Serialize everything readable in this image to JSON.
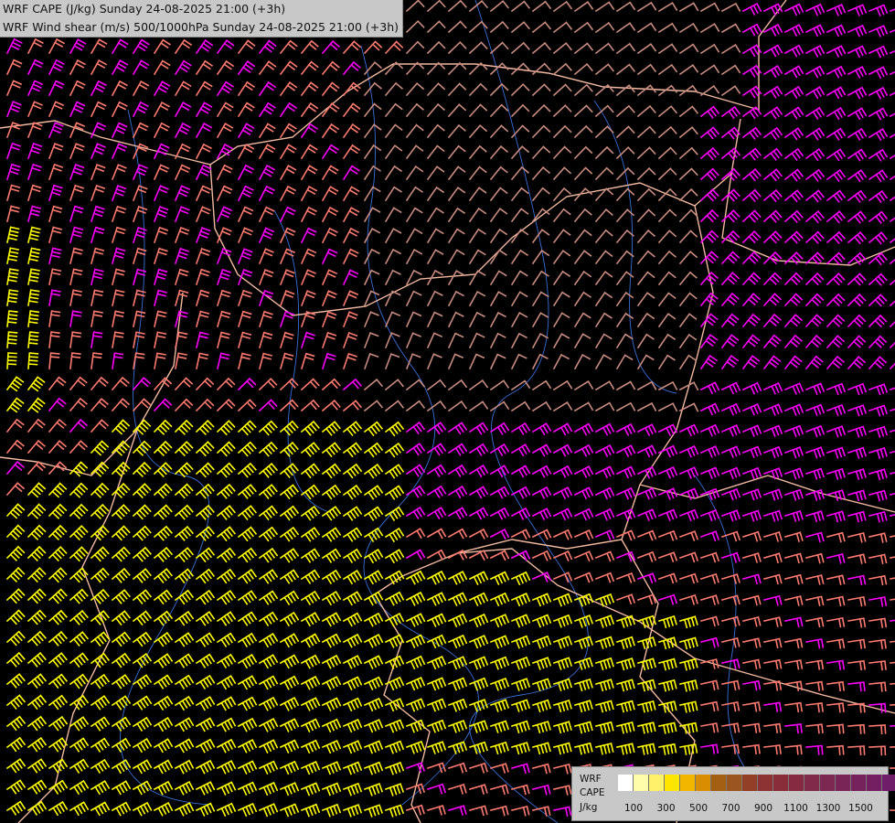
{
  "header": {
    "line1": "WRF CAPE (J/kg) Sunday 24-08-2025 21:00 (+3h)",
    "line2": "WRF Wind shear (m/s) 500/1000hPa Sunday 24-08-2025 21:00 (+3h)"
  },
  "legend": {
    "line_wrf": "WRF",
    "line_cape": "CAPE",
    "line_unit": "J/kg",
    "colors": [
      "#ffffff",
      "#fffcaa",
      "#fff26a",
      "#ffe600",
      "#f2b500",
      "#d98d00",
      "#a35f12",
      "#9a5520",
      "#933e26",
      "#8e3333",
      "#8a2d3a",
      "#862a42",
      "#822a4a",
      "#7d2852",
      "#7a2558",
      "#76235d",
      "#731f62",
      "#6f1d68",
      "#6b1a6d"
    ],
    "ticks": [
      "100",
      "300",
      "500",
      "700",
      "900",
      "1100",
      "1300",
      "1500"
    ]
  },
  "colors": {
    "background": "#000000",
    "border_lines": "#f2b8a0",
    "rivers": "#3a6fd8",
    "barb_low_shear": "#c98c80",
    "barb_mid_shear": "#ff7a70",
    "barb_high_shear": "#ff00ff",
    "barb_cape": "#ffff00"
  }
}
